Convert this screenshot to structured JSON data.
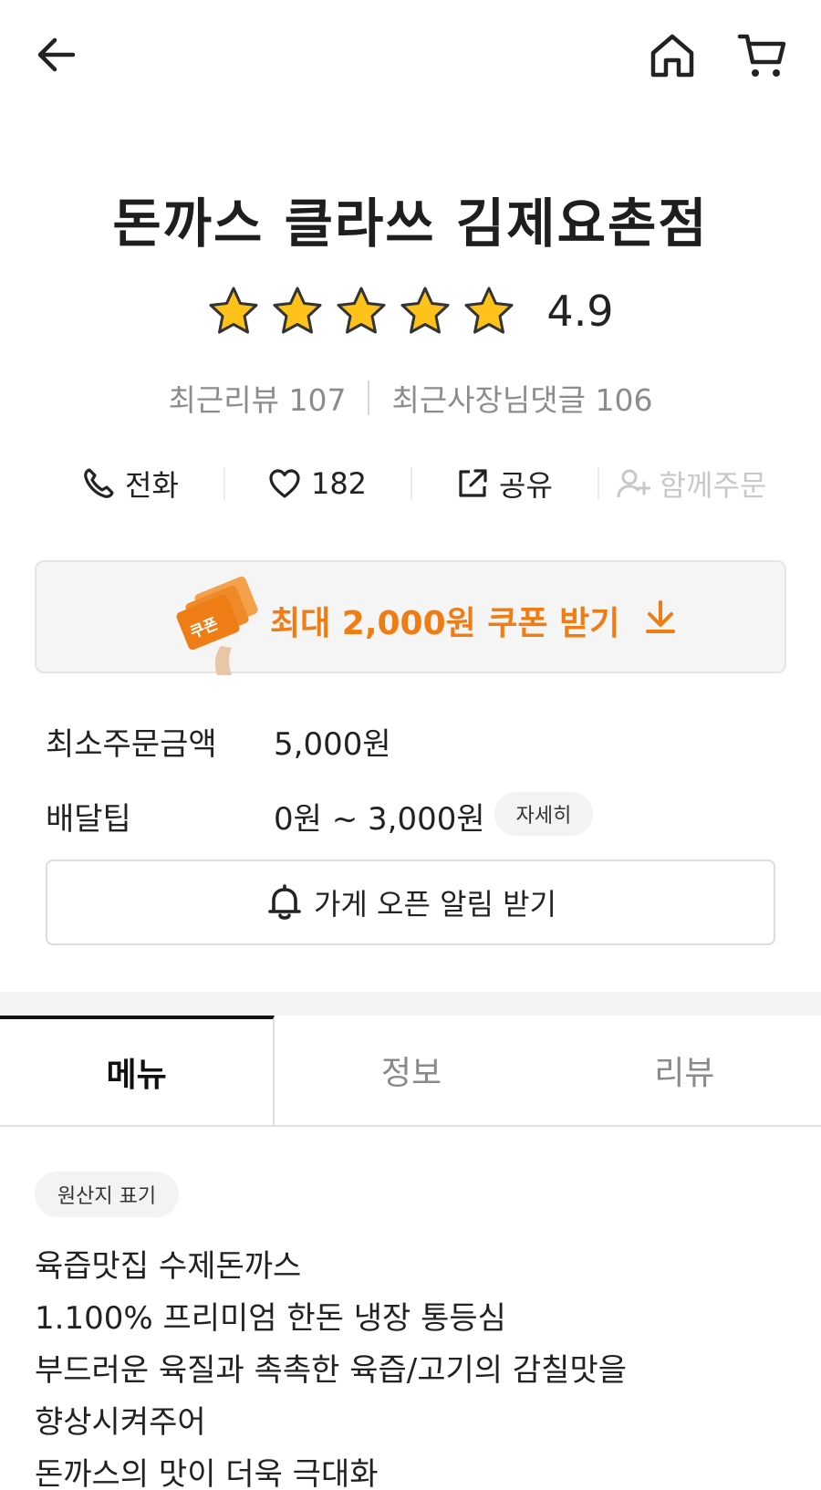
{
  "store": {
    "name": "돈까스 클라쓰 김제요촌점",
    "rating": "4.9",
    "star_count": 5,
    "recent_reviews": "최근리뷰 107",
    "recent_owner_replies": "최근사장님댓글 106"
  },
  "actions": {
    "call_label": "전화",
    "likes_count": "182",
    "share_label": "공유",
    "group_order_label": "함께주문"
  },
  "coupon": {
    "label": "최대 2,000원 쿠폰 받기",
    "image_text": "쿠폰",
    "accent_color": "#f07c14"
  },
  "order_info": {
    "min_order_label": "최소주문금액",
    "min_order_value": "5,000원",
    "delivery_tip_label": "배달팁",
    "delivery_tip_value": "0원 ~ 3,000원",
    "detail_button": "자세히"
  },
  "alarm_button": "가게 오픈 알림 받기",
  "tabs": [
    {
      "label": "메뉴",
      "active": true
    },
    {
      "label": "정보",
      "active": false
    },
    {
      "label": "리뷰",
      "active": false
    }
  ],
  "origin_chip": "원산지 표기",
  "description": [
    "육즙맛집 수제돈까스",
    "1.100% 프리미엄 한돈 냉장 통등심",
    "부드러운 육질과 촉촉한 육즙/고기의 감칠맛을",
    "향상시켜주어",
    "돈까스의 맛이 더욱 극대화"
  ],
  "icons": {
    "back": "arrow-left-icon",
    "home": "home-icon",
    "cart": "cart-icon",
    "star": "star-icon",
    "call": "phone-icon",
    "like": "heart-icon",
    "share": "share-icon",
    "group": "person-add-icon",
    "download": "arrow-down-icon",
    "alarm": "bell-icon"
  }
}
